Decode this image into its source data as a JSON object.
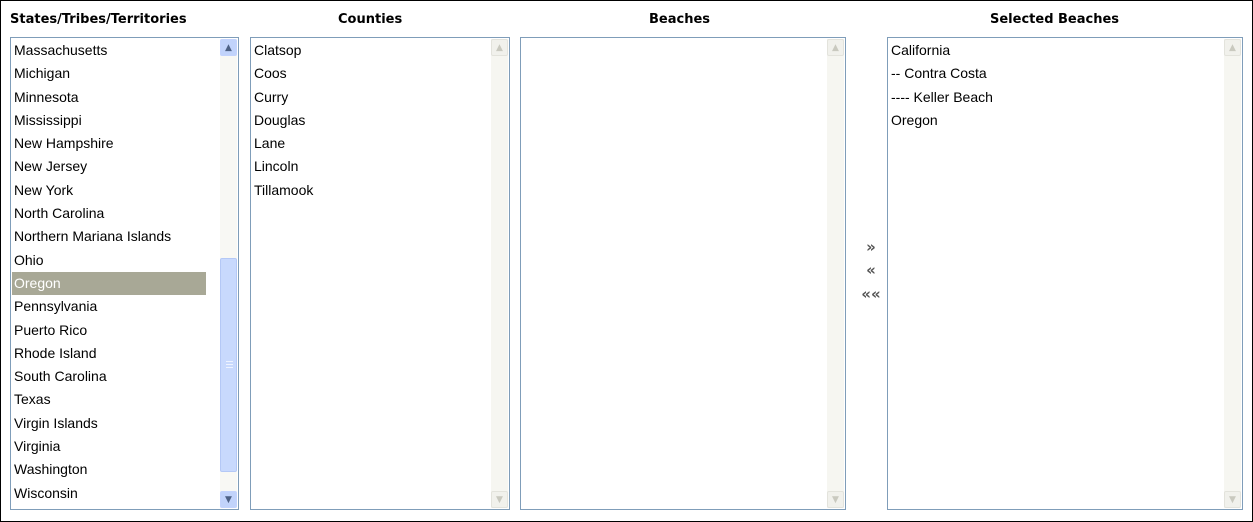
{
  "columns": {
    "states": "States/Tribes/Territories",
    "counties": "Counties",
    "beaches": "Beaches",
    "selected": "Selected Beaches"
  },
  "states_list": [
    "Massachusetts",
    "Michigan",
    "Minnesota",
    "Mississippi",
    "New Hampshire",
    "New Jersey",
    "New York",
    "North Carolina",
    "Northern Mariana Islands",
    "Ohio",
    "Oregon",
    "Pennsylvania",
    "Puerto Rico",
    "Rhode Island",
    "South Carolina",
    "Texas",
    "Virgin Islands",
    "Virginia",
    "Washington",
    "Wisconsin"
  ],
  "states_selected": "Oregon",
  "counties_list": [
    "Clatsop",
    "Coos",
    "Curry",
    "Douglas",
    "Lane",
    "Lincoln",
    "Tillamook"
  ],
  "beaches_list": [],
  "selected_list": [
    "California",
    "-- Contra Costa",
    "---- Keller Beach",
    "Oregon"
  ],
  "buttons": {
    "add": "»",
    "remove": "«",
    "remove_all": "«« "
  },
  "colors": {
    "selected_bg": "#a8a896",
    "list_border": "#7f9db9",
    "scrollbar": "#c1d3fb"
  }
}
